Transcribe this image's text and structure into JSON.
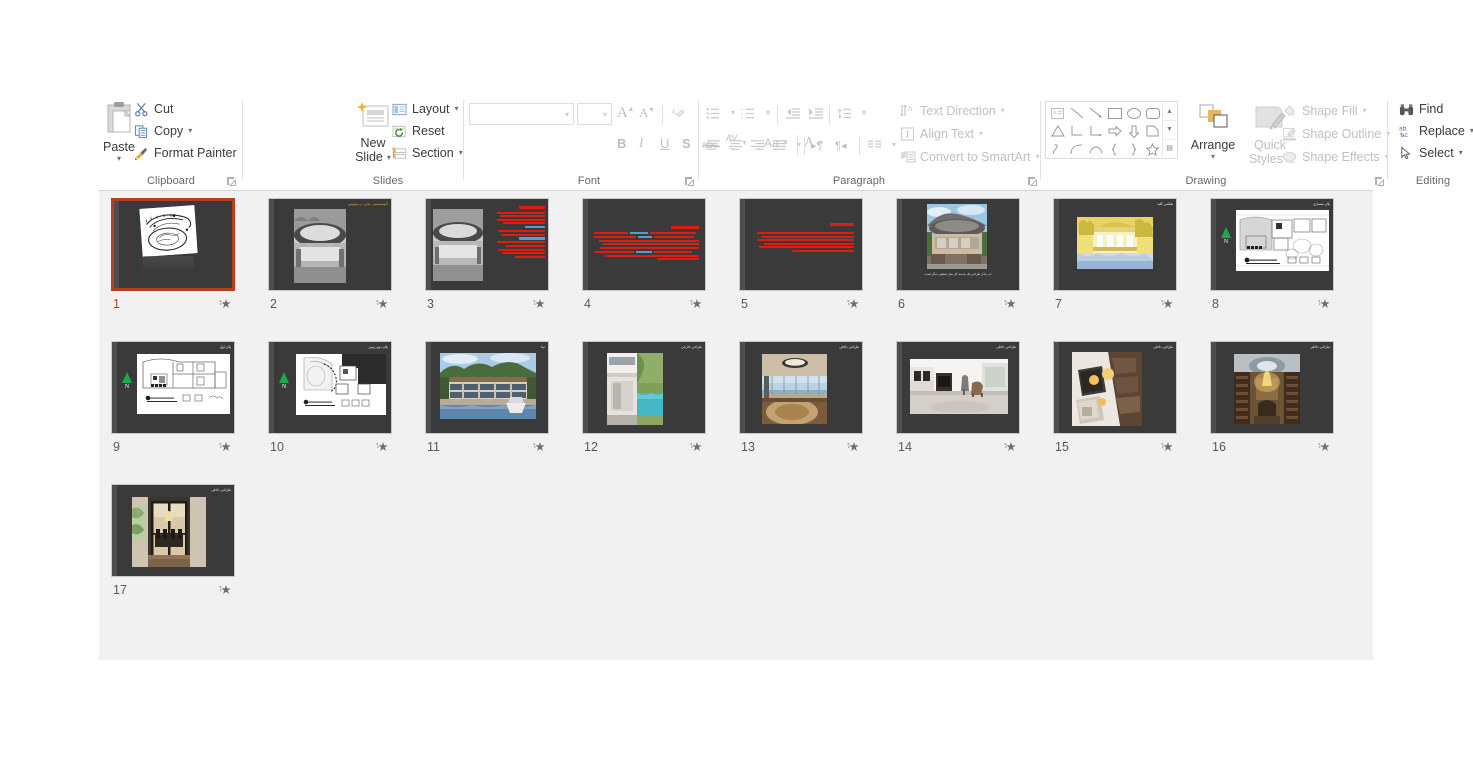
{
  "app": {
    "name": "PowerPoint Slide Sorter",
    "accent_color": "#b5401f",
    "canvas_color": "#f1f1f1",
    "slide_bg_color": "#3a3a3a"
  },
  "ribbon": {
    "groups": [
      {
        "id": "clipboard",
        "label": "Clipboard",
        "has_dialog_launcher": true,
        "commands": [
          {
            "id": "paste",
            "label": "Paste",
            "icon": "clipboard-icon",
            "has_caret": true,
            "disabled": false
          },
          {
            "id": "cut",
            "label": "Cut",
            "icon": "scissors-icon",
            "has_caret": false,
            "disabled": false
          },
          {
            "id": "copy",
            "label": "Copy",
            "icon": "copy-icon",
            "has_caret": true,
            "disabled": false
          },
          {
            "id": "format-painter",
            "label": "Format Painter",
            "icon": "paintbrush-icon",
            "has_caret": false,
            "disabled": false
          }
        ]
      },
      {
        "id": "slides",
        "label": "Slides",
        "has_dialog_launcher": false,
        "commands": [
          {
            "id": "new-slide",
            "label": "New Slide",
            "icon": "new-slide-icon",
            "has_caret": true,
            "disabled": false
          },
          {
            "id": "layout",
            "label": "Layout",
            "icon": "layout-icon",
            "has_caret": true,
            "disabled": false
          },
          {
            "id": "reset",
            "label": "Reset",
            "icon": "reset-icon",
            "has_caret": false,
            "disabled": false
          },
          {
            "id": "section",
            "label": "Section",
            "icon": "section-icon",
            "has_caret": true,
            "disabled": false
          }
        ]
      },
      {
        "id": "font",
        "label": "Font",
        "has_dialog_launcher": true,
        "font_name_value": "",
        "font_size_value": "",
        "commands": [
          {
            "id": "grow-font",
            "label": "A",
            "icon": "grow-font-icon",
            "has_caret": false,
            "disabled": true
          },
          {
            "id": "shrink-font",
            "label": "A",
            "icon": "shrink-font-icon",
            "has_caret": false,
            "disabled": true
          },
          {
            "id": "clear-formatting",
            "label": "",
            "icon": "clear-formatting-icon",
            "has_caret": false,
            "disabled": true
          },
          {
            "id": "bold",
            "label": "B",
            "icon": "bold-icon",
            "has_caret": false,
            "disabled": true
          },
          {
            "id": "italic",
            "label": "I",
            "icon": "italic-icon",
            "has_caret": false,
            "disabled": true
          },
          {
            "id": "underline",
            "label": "U",
            "icon": "underline-icon",
            "has_caret": false,
            "disabled": true
          },
          {
            "id": "text-shadow",
            "label": "S",
            "icon": "text-shadow-icon",
            "has_caret": false,
            "disabled": true
          },
          {
            "id": "strikethrough",
            "label": "abc",
            "icon": "strikethrough-icon",
            "has_caret": false,
            "disabled": true
          },
          {
            "id": "character-spacing",
            "label": "AV",
            "icon": "character-spacing-icon",
            "has_caret": true,
            "disabled": true
          },
          {
            "id": "change-case",
            "label": "Aa",
            "icon": "change-case-icon",
            "has_caret": true,
            "disabled": true
          },
          {
            "id": "font-color",
            "label": "A",
            "icon": "font-color-icon",
            "has_caret": true,
            "disabled": true
          }
        ]
      },
      {
        "id": "paragraph",
        "label": "Paragraph",
        "has_dialog_launcher": true,
        "commands": [
          {
            "id": "bullets",
            "label": "",
            "icon": "bullet-list-icon",
            "has_caret": true,
            "disabled": true
          },
          {
            "id": "numbering",
            "label": "",
            "icon": "numbered-list-icon",
            "has_caret": true,
            "disabled": true
          },
          {
            "id": "decrease-indent",
            "label": "",
            "icon": "decrease-indent-icon",
            "has_caret": false,
            "disabled": true
          },
          {
            "id": "increase-indent",
            "label": "",
            "icon": "increase-indent-icon",
            "has_caret": false,
            "disabled": true
          },
          {
            "id": "line-spacing",
            "label": "",
            "icon": "line-spacing-icon",
            "has_caret": true,
            "disabled": true
          },
          {
            "id": "align-left",
            "label": "",
            "icon": "align-left-icon",
            "has_caret": false,
            "disabled": true
          },
          {
            "id": "align-center",
            "label": "",
            "icon": "align-center-icon",
            "has_caret": false,
            "disabled": true
          },
          {
            "id": "align-right",
            "label": "",
            "icon": "align-right-icon",
            "has_caret": false,
            "disabled": true
          },
          {
            "id": "justify",
            "label": "",
            "icon": "justify-icon",
            "has_caret": true,
            "disabled": true
          },
          {
            "id": "ltr-text",
            "label": "",
            "icon": "left-to-right-icon",
            "has_caret": false,
            "disabled": true
          },
          {
            "id": "rtl-text",
            "label": "",
            "icon": "right-to-left-icon",
            "has_caret": false,
            "disabled": true
          },
          {
            "id": "columns",
            "label": "",
            "icon": "columns-icon",
            "has_caret": true,
            "disabled": true
          },
          {
            "id": "text-direction",
            "label": "Text Direction",
            "icon": "text-direction-icon",
            "has_caret": true,
            "disabled": true
          },
          {
            "id": "align-text",
            "label": "Align Text",
            "icon": "align-text-icon",
            "has_caret": true,
            "disabled": true
          },
          {
            "id": "convert-to-smartart",
            "label": "Convert to SmartArt",
            "icon": "smartart-icon",
            "has_caret": true,
            "disabled": true
          }
        ]
      },
      {
        "id": "drawing",
        "label": "Drawing",
        "has_dialog_launcher": true,
        "commands": [
          {
            "id": "arrange",
            "label": "Arrange",
            "icon": "arrange-icon",
            "has_caret": true,
            "disabled": false
          },
          {
            "id": "quick-styles",
            "label": "Quick Styles",
            "icon": "quick-styles-icon",
            "has_caret": true,
            "disabled": true
          },
          {
            "id": "shape-fill",
            "label": "Shape Fill",
            "icon": "shape-fill-icon",
            "has_caret": true,
            "disabled": true
          },
          {
            "id": "shape-outline",
            "label": "Shape Outline",
            "icon": "shape-outline-icon",
            "has_caret": true,
            "disabled": true
          },
          {
            "id": "shape-effects",
            "label": "Shape Effects",
            "icon": "shape-effects-icon",
            "has_caret": true,
            "disabled": true
          }
        ],
        "shapes": [
          "textbox-shape",
          "line-shape",
          "arrow-line-shape",
          "rectangle-shape",
          "oval-shape",
          "rounded-rectangle-shape",
          "triangle-shape",
          "elbow-connector-shape",
          "elbow-arrow-shape",
          "right-arrow-shape",
          "down-arrow-shape",
          "pentagon-shape",
          "freeform-shape",
          "curve-shape",
          "arc-shape",
          "left-brace-shape",
          "right-brace-shape",
          "star-shape"
        ],
        "gallery_scroll": [
          "scroll-up",
          "scroll-down",
          "more-shapes"
        ]
      },
      {
        "id": "editing",
        "label": "Editing",
        "has_dialog_launcher": false,
        "commands": [
          {
            "id": "find",
            "label": "Find",
            "icon": "binoculars-icon",
            "has_caret": false,
            "disabled": false
          },
          {
            "id": "replace",
            "label": "Replace",
            "icon": "replace-icon",
            "has_caret": true,
            "disabled": false
          },
          {
            "id": "select",
            "label": "Select",
            "icon": "select-pointer-icon",
            "has_caret": true,
            "disabled": false
          }
        ]
      }
    ]
  },
  "sorter": {
    "selected_slide": 1,
    "slide_count": 17,
    "animation_icon": "animation-star-icon",
    "slides": [
      {
        "number": "1",
        "title": "",
        "kind": "sketch-cover",
        "selected": true
      },
      {
        "number": "2",
        "title": "اکوسیستم - بنایی در سوئیس",
        "kind": "photo-bw-portrait",
        "selected": false
      },
      {
        "number": "3",
        "title": "هنر دوره",
        "kind": "photo-bw-with-text",
        "selected": false
      },
      {
        "number": "4",
        "title": "الرصوصیة",
        "kind": "text-only-center",
        "selected": false
      },
      {
        "number": "5",
        "title": "وحدة اندرونی",
        "kind": "text-only-right",
        "selected": false
      },
      {
        "number": "6",
        "title": "اب بنا از طراحی یک جدیده کار ساز تحقیقی دیگر است",
        "kind": "photo-color-portrait",
        "selected": false
      },
      {
        "number": "7",
        "title": "نقاشی کلید",
        "kind": "painting-yellow",
        "selected": false
      },
      {
        "number": "8",
        "title": "پلان معماری",
        "kind": "site-plan",
        "selected": false
      },
      {
        "number": "9",
        "title": "پلان اول",
        "kind": "floor-plan-1",
        "selected": false
      },
      {
        "number": "10",
        "title": "پلان دوم زمین",
        "kind": "floor-plan-2",
        "selected": false
      },
      {
        "number": "11",
        "title": "نما",
        "kind": "photo-exterior-wide",
        "selected": false
      },
      {
        "number": "12",
        "title": "طراحی خارجی",
        "kind": "photo-pool",
        "selected": false
      },
      {
        "number": "13",
        "title": "طراحی داخلی",
        "kind": "photo-interior-curve",
        "selected": false
      },
      {
        "number": "14",
        "title": "طراحی داخلی",
        "kind": "photo-living-room",
        "selected": false
      },
      {
        "number": "15",
        "title": "طراحی داخلی",
        "kind": "photo-stairs",
        "selected": false
      },
      {
        "number": "16",
        "title": "طراحی داخلی",
        "kind": "photo-library",
        "selected": false
      },
      {
        "number": "17",
        "title": "طراحی داخلی",
        "kind": "photo-dining",
        "selected": false
      }
    ]
  }
}
